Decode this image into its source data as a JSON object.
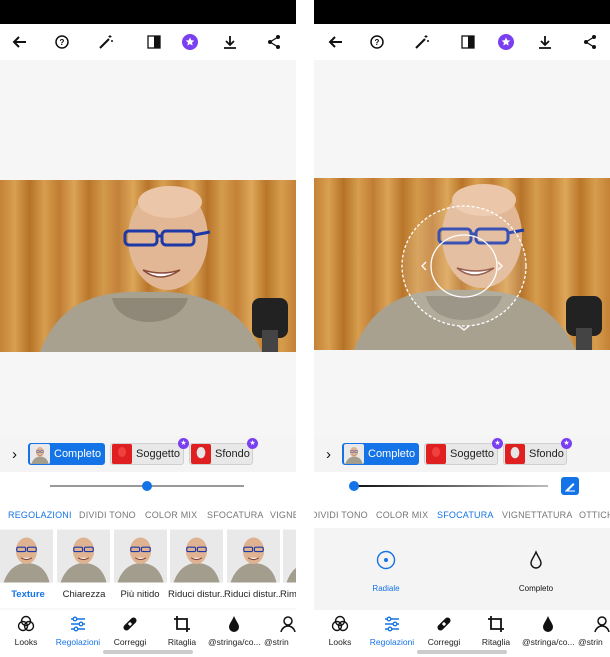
{
  "colors": {
    "accent": "#1473e6",
    "premium": "#7b3ff2"
  },
  "left": {
    "masks": [
      {
        "label": "Completo",
        "active": true
      },
      {
        "label": "Soggetto",
        "premium": true
      },
      {
        "label": "Sfondo",
        "premium": true
      }
    ],
    "slider_level": 0.5,
    "tabs": [
      {
        "label": "REGOLAZIONI",
        "active": true
      },
      {
        "label": "DIVIDI TONO"
      },
      {
        "label": "COLOR MIX"
      },
      {
        "label": "SFOCATURA"
      },
      {
        "label": "VIGNE"
      }
    ],
    "presets": [
      "Texture",
      "Chiarezza",
      "Più nitido",
      "Riduci distur...",
      "Riduci distur...",
      "Rim"
    ],
    "nav": [
      {
        "label": "Looks",
        "icon": "looks-icon"
      },
      {
        "label": "Regolazioni",
        "icon": "adjustments-icon",
        "active": true
      },
      {
        "label": "Correggi",
        "icon": "heal-icon"
      },
      {
        "label": "Ritaglia",
        "icon": "crop-icon"
      },
      {
        "label": "@stringa/co...",
        "icon": "drop-icon"
      },
      {
        "label": "@strin",
        "icon": "person-icon"
      }
    ]
  },
  "right": {
    "masks": [
      {
        "label": "Completo",
        "active": true
      },
      {
        "label": "Soggetto",
        "premium": true
      },
      {
        "label": "Sfondo",
        "premium": true
      }
    ],
    "slider_level": 0.0,
    "tabs": [
      {
        "label": "DIVIDI TONO"
      },
      {
        "label": "COLOR MIX"
      },
      {
        "label": "SFOCATURA",
        "active": true
      },
      {
        "label": "VIGNETTATURA"
      },
      {
        "label": "OTTICH"
      }
    ],
    "modes": [
      {
        "label": "Radiale",
        "icon": "radial-icon",
        "active": true
      },
      {
        "label": "Completo",
        "icon": "drop-icon"
      }
    ],
    "nav": [
      {
        "label": "Looks",
        "icon": "looks-icon"
      },
      {
        "label": "Regolazioni",
        "icon": "adjustments-icon",
        "active": true
      },
      {
        "label": "Correggi",
        "icon": "heal-icon"
      },
      {
        "label": "Ritaglia",
        "icon": "crop-icon"
      },
      {
        "label": "@stringa/co...",
        "icon": "drop-icon"
      },
      {
        "label": "@strin",
        "icon": "person-icon"
      }
    ]
  }
}
